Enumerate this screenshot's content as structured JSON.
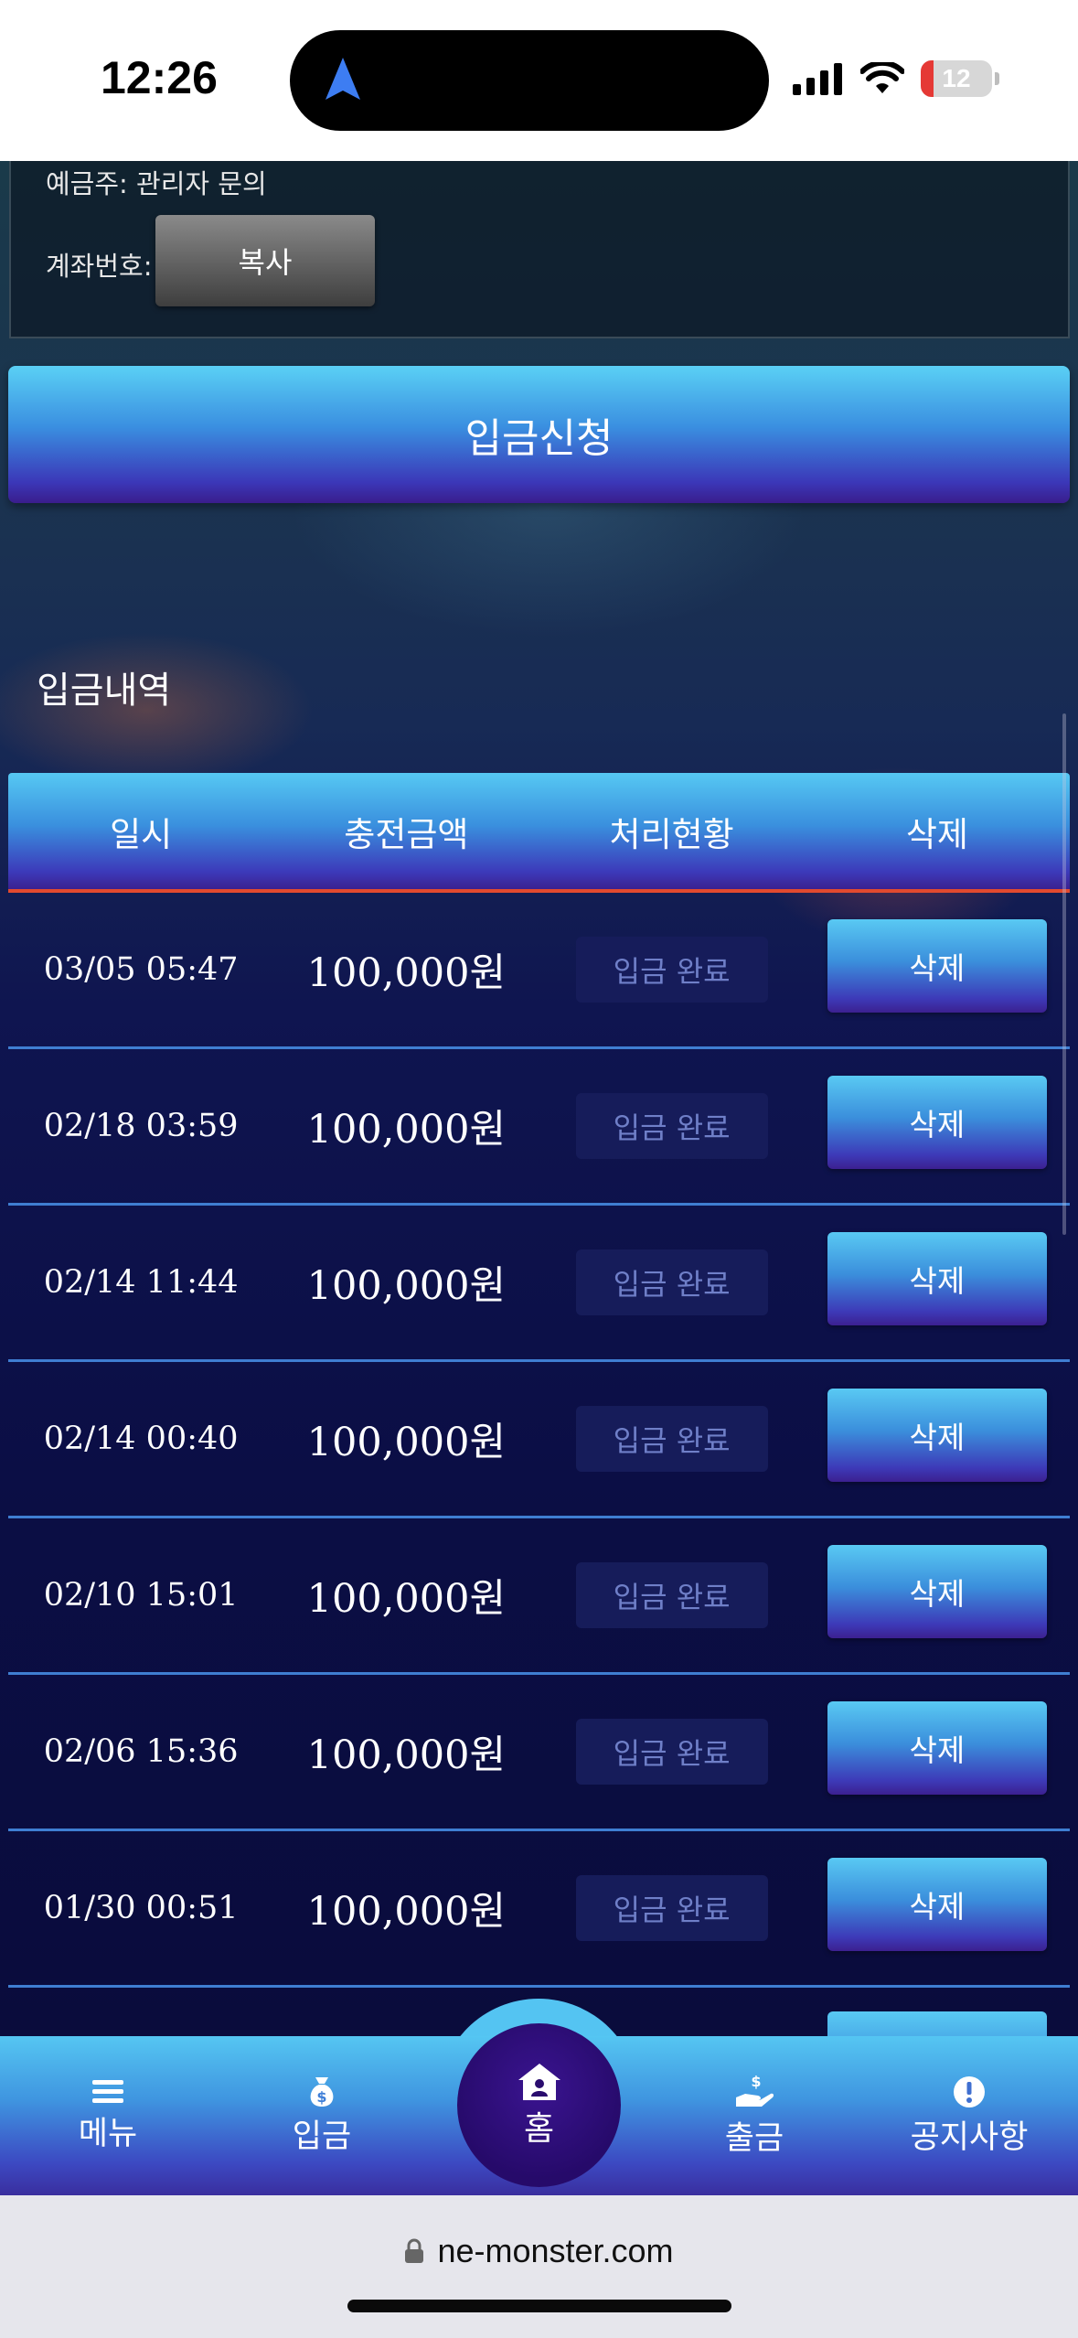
{
  "status_bar": {
    "time": "12:26",
    "battery": "12"
  },
  "account": {
    "depositor_line": "예금주: 관리자 문의",
    "account_label": "계좌번호:",
    "copy_label": "복사"
  },
  "deposit_request_label": "입금신청",
  "history": {
    "title": "입금내역",
    "headers": [
      "일시",
      "충전금액",
      "처리현황",
      "삭제"
    ],
    "rows": [
      {
        "date": "03/05 05:47",
        "amount": "100,000원",
        "status": "입금 완료",
        "action": "삭제"
      },
      {
        "date": "02/18 03:59",
        "amount": "100,000원",
        "status": "입금 완료",
        "action": "삭제"
      },
      {
        "date": "02/14 11:44",
        "amount": "100,000원",
        "status": "입금 완료",
        "action": "삭제"
      },
      {
        "date": "02/14 00:40",
        "amount": "100,000원",
        "status": "입금 완료",
        "action": "삭제"
      },
      {
        "date": "02/10 15:01",
        "amount": "100,000원",
        "status": "입금 완료",
        "action": "삭제"
      },
      {
        "date": "02/06 15:36",
        "amount": "100,000원",
        "status": "입금 완료",
        "action": "삭제"
      },
      {
        "date": "01/30 00:51",
        "amount": "100,000원",
        "status": "입금 완료",
        "action": "삭제"
      }
    ]
  },
  "bottom_nav": {
    "menu": "메뉴",
    "deposit": "입금",
    "home": "홈",
    "withdraw": "출금",
    "notice": "공지사항"
  },
  "browser": {
    "url": "ne-monster.com"
  },
  "colors": {
    "accent_top": "#56c8f3",
    "accent_bottom": "#3b2190",
    "header_underline": "#e24a2f",
    "status_text": "#6f7fc8"
  }
}
